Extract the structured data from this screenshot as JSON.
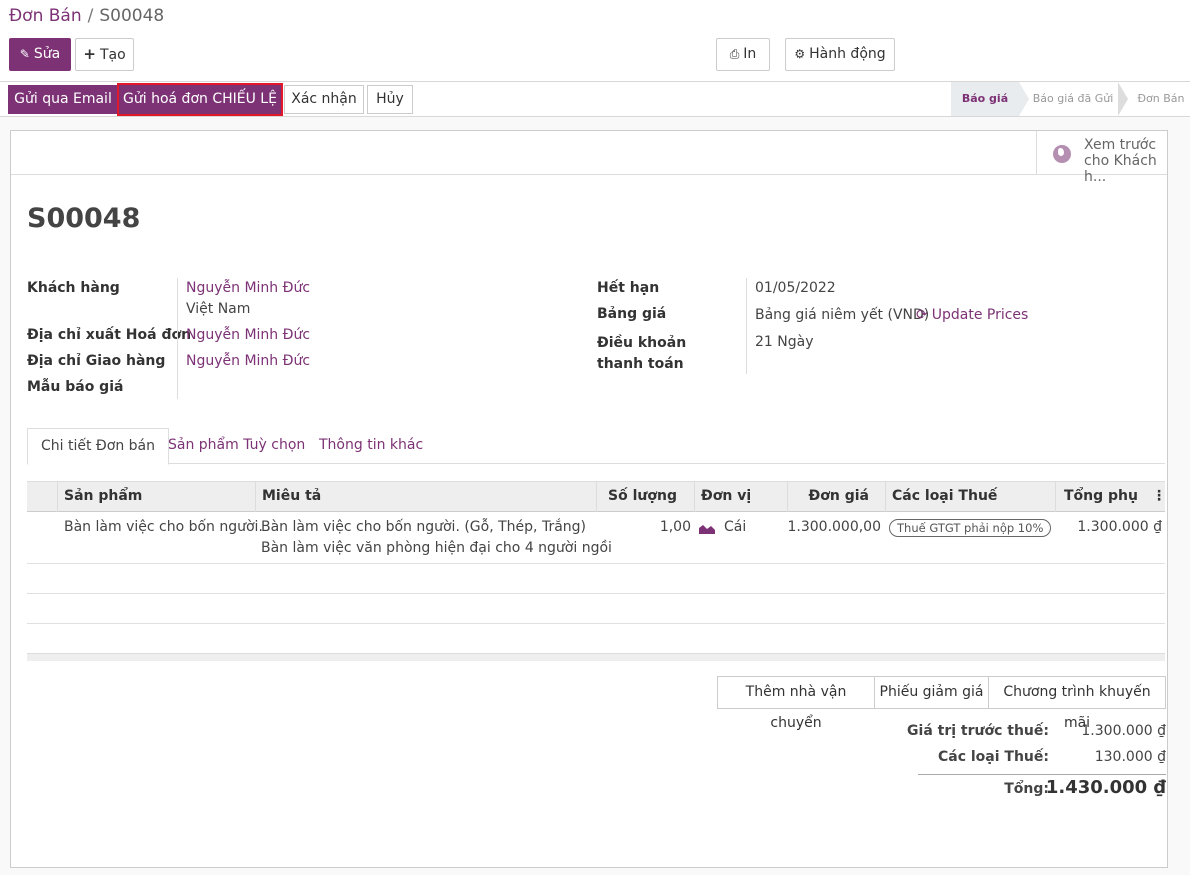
{
  "breadcrumb": {
    "parent": "Đơn Bán",
    "separator": "/",
    "current": "S00048"
  },
  "toolbar": {
    "edit": "Sửa",
    "create": "Tạo",
    "print": "In",
    "action": "Hành động"
  },
  "statusbar": {
    "buttons": [
      "Gửi qua Email",
      "Gửi hoá đơn CHIẾU LỆ",
      "Xác nhận",
      "Hủy"
    ],
    "stages": [
      "Báo giá",
      "Báo giá đã Gửi",
      "Đơn Bán"
    ],
    "active_stage": "Báo giá"
  },
  "preview": {
    "label": "Xem trước cho Khách h..."
  },
  "order": {
    "name": "S00048"
  },
  "fields_left": {
    "customer_label": "Khách hàng",
    "customer": "Nguyễn Minh Đức",
    "customer_country": "Việt Nam",
    "invoice_addr_label": "Địa chỉ xuất Hoá đơn",
    "invoice_addr": "Nguyễn Minh Đức",
    "delivery_addr_label": "Địa chỉ Giao hàng",
    "delivery_addr": "Nguyễn Minh Đức",
    "template_label": "Mẫu báo giá"
  },
  "fields_right": {
    "expiry_label": "Hết hạn",
    "expiry": "01/05/2022",
    "pricelist_label": "Bảng giá",
    "pricelist": "Bảng giá niêm yết (VND)",
    "update_prices": "Update Prices",
    "payment_terms_label": "Điều khoản thanh toán",
    "payment_terms": "21 Ngày"
  },
  "tabs": [
    "Chi tiết Đơn bán",
    "Sản phẩm Tuỳ chọn",
    "Thông tin khác"
  ],
  "table": {
    "headers": [
      "Sản phẩm",
      "Miêu tả",
      "Số lượng",
      "Đơn vị",
      "Đơn giá",
      "Các loại Thuế",
      "Tổng phụ"
    ],
    "rows": [
      {
        "product": "Bàn làm việc cho bốn người.",
        "description_line1": "Bàn làm việc cho bốn người. (Gỗ, Thép, Trắng)",
        "description_line2": "Bàn làm việc văn phòng hiện đại cho 4 người ngồi",
        "quantity": "1,00",
        "uom": "Cái",
        "price_unit": "1.300.000,00",
        "tax": "Thuế GTGT phải nộp 10%",
        "subtotal": "1.300.000 ₫"
      }
    ]
  },
  "order_buttons": [
    "Thêm nhà vận chuyển",
    "Phiếu giảm giá",
    "Chương trình khuyến mãi"
  ],
  "totals": {
    "untaxed_label": "Giá trị trước thuế:",
    "untaxed": "1.300.000 ₫",
    "taxes_label": "Các loại Thuế:",
    "taxes": "130.000 ₫",
    "total_label": "Tổng:",
    "total": "1.430.000 ₫"
  },
  "colors": {
    "brand": "#7c3275",
    "highlight": "#e0182a"
  }
}
